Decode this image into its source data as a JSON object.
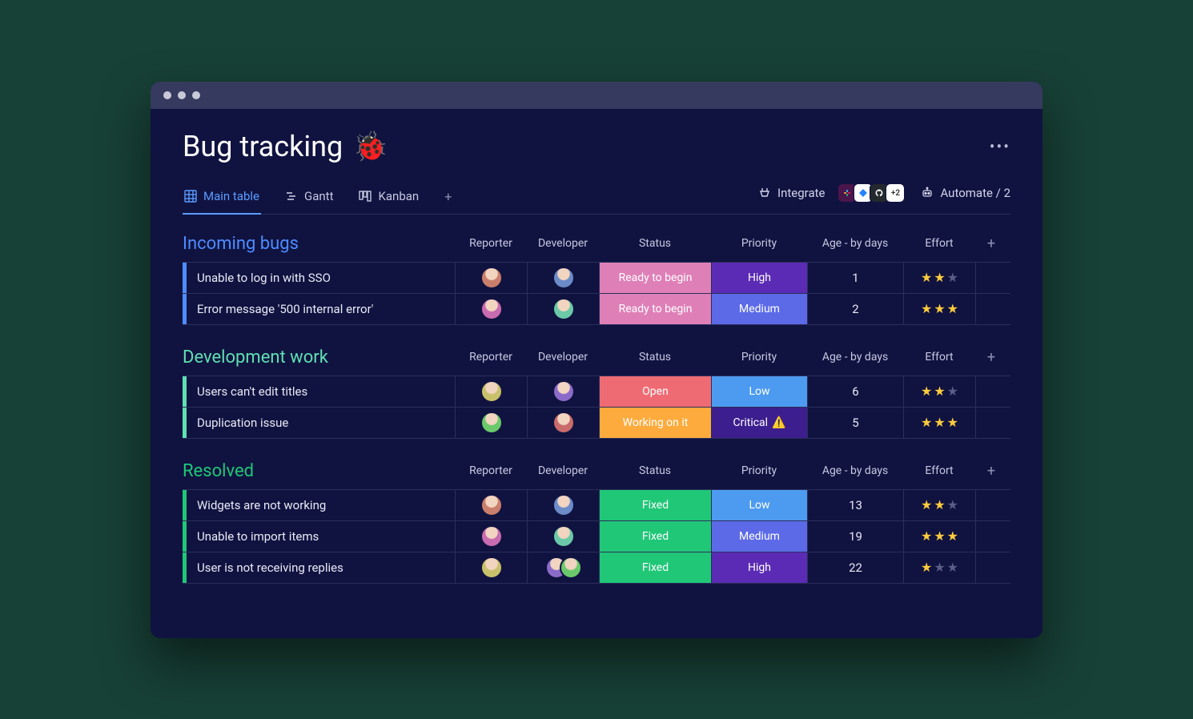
{
  "board": {
    "title": "Bug tracking",
    "title_emoji": "🐞",
    "more_icon": "•••"
  },
  "tabs": {
    "items": [
      {
        "label": "Main table",
        "icon": "grid"
      },
      {
        "label": "Gantt",
        "icon": "gantt"
      },
      {
        "label": "Kanban",
        "icon": "kanban"
      }
    ],
    "add": "+"
  },
  "actions": {
    "integrate_label": "Integrate",
    "integrations_more": "+2",
    "automate_label": "Automate / 2"
  },
  "columns": {
    "reporter": "Reporter",
    "developer": "Developer",
    "status": "Status",
    "priority": "Priority",
    "age": "Age - by days",
    "effort": "Effort",
    "add": "+"
  },
  "status_colors": {
    "Ready to begin": "#df7fb7",
    "Open": "#ef6b74",
    "Working on it": "#fdab3d",
    "Fixed": "#1fc777"
  },
  "priority_colors": {
    "High": "#5b2bb5",
    "Medium": "#5c6ae8",
    "Low": "#4d9bf0",
    "Critical": "#3d1e8f"
  },
  "avatar_palette": [
    "#c97f6b",
    "#6b8bc9",
    "#c96bb0",
    "#6bc9a7",
    "#c9c06b",
    "#8b6bc9",
    "#6bc96b",
    "#c96b6b"
  ],
  "groups": [
    {
      "title": "Incoming bugs",
      "color": "#4d8bff",
      "rows": [
        {
          "name": "Unable to log in with SSO",
          "reporter": 1,
          "developer": 1,
          "status": "Ready to begin",
          "priority": "High",
          "age": "1",
          "effort": 2
        },
        {
          "name": "Error message '500 internal error'",
          "reporter": 1,
          "developer": 1,
          "status": "Ready to begin",
          "priority": "Medium",
          "age": "2",
          "effort": 3
        }
      ]
    },
    {
      "title": "Development work",
      "color": "#5fe0b2",
      "rows": [
        {
          "name": "Users can't edit titles",
          "reporter": 1,
          "developer": 1,
          "status": "Open",
          "priority": "Low",
          "age": "6",
          "effort": 2
        },
        {
          "name": "Duplication issue",
          "reporter": 1,
          "developer": 1,
          "status": "Working on it",
          "priority": "Critical",
          "priority_warn": true,
          "age": "5",
          "effort": 3
        }
      ]
    },
    {
      "title": "Resolved",
      "color": "#1fc777",
      "rows": [
        {
          "name": "Widgets are not working",
          "reporter": 1,
          "developer": 1,
          "status": "Fixed",
          "priority": "Low",
          "age": "13",
          "effort": 2
        },
        {
          "name": "Unable to import items",
          "reporter": 1,
          "developer": 1,
          "status": "Fixed",
          "priority": "Medium",
          "age": "19",
          "effort": 3
        },
        {
          "name": "User is not receiving replies",
          "reporter": 1,
          "developer": 2,
          "status": "Fixed",
          "priority": "High",
          "age": "22",
          "effort": 1
        }
      ]
    }
  ]
}
